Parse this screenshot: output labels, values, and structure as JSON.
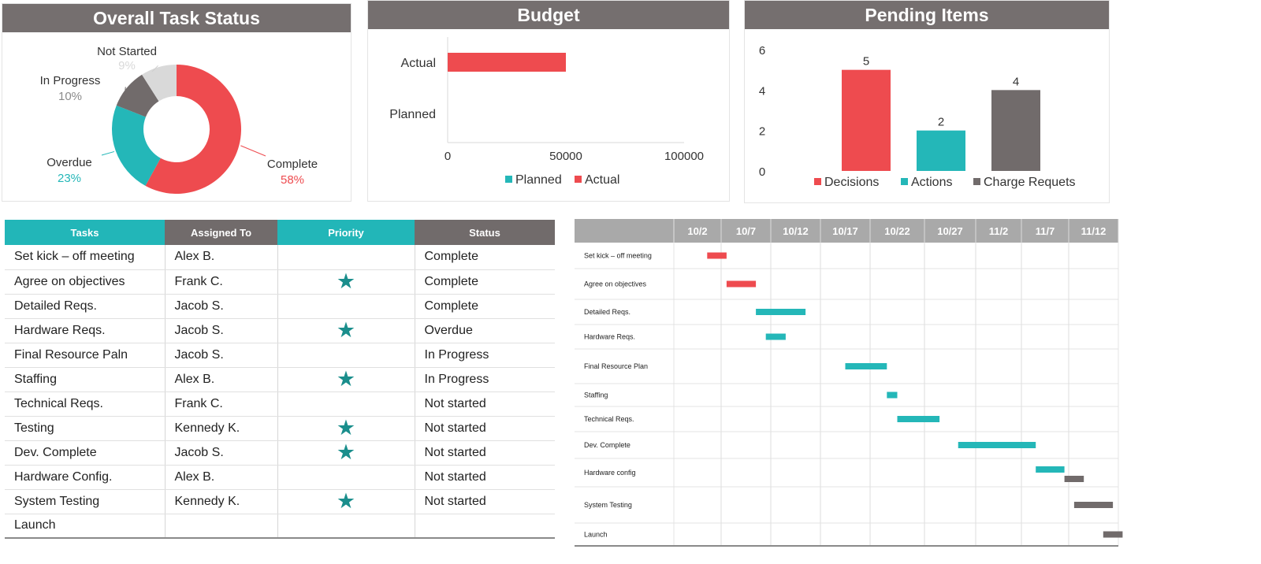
{
  "task_status": {
    "title": "Overall Task Status",
    "chart_data": {
      "type": "pie",
      "labels": [
        "Complete",
        "Overdue",
        "In Progress",
        "Not Started"
      ],
      "values": [
        58,
        23,
        10,
        9
      ],
      "value_labels": [
        "58%",
        "23%",
        "10%",
        "9%"
      ],
      "colors": [
        "#ee4b4f",
        "#24b7b8",
        "#716b6b",
        "#d9d9d9"
      ],
      "donut": true
    }
  },
  "budget": {
    "title": "Budget",
    "chart_data": {
      "type": "bar",
      "orientation": "horizontal",
      "categories": [
        "Actual",
        "Planned"
      ],
      "series": [
        {
          "name": "Planned",
          "values": [
            0,
            0
          ],
          "color": "#24b7b8"
        },
        {
          "name": "Actual",
          "values": [
            50000,
            0
          ],
          "color": "#ee4b4f"
        }
      ],
      "xlim": [
        0,
        100000
      ],
      "xticks": [
        "0",
        "50000",
        "100000"
      ],
      "legend": "bottom"
    }
  },
  "pending": {
    "title": "Pending Items",
    "chart_data": {
      "type": "bar",
      "categories": [
        "Decisions",
        "Actions",
        "Charge Requets"
      ],
      "values": [
        5,
        2,
        4
      ],
      "colors": [
        "#ee4b4f",
        "#24b7b8",
        "#716b6b"
      ],
      "ylim": [
        0,
        6
      ],
      "yticks": [
        "0",
        "2",
        "4",
        "6"
      ],
      "legend": "bottom"
    }
  },
  "task_table": {
    "headers": [
      "Tasks",
      "Assigned To",
      "Priority",
      "Status"
    ],
    "star_glyph": "★",
    "rows": [
      {
        "task": "Set kick – off meeting",
        "assigned": "Alex B.",
        "priority": false,
        "status": "Complete"
      },
      {
        "task": "Agree on objectives",
        "assigned": "Frank C.",
        "priority": true,
        "status": "Complete"
      },
      {
        "task": "Detailed Reqs.",
        "assigned": "Jacob S.",
        "priority": false,
        "status": "Complete"
      },
      {
        "task": "Hardware  Reqs.",
        "assigned": "Jacob S.",
        "priority": true,
        "status": "Overdue"
      },
      {
        "task": "Final Resource Paln",
        "assigned": "Jacob S.",
        "priority": false,
        "status": "In Progress"
      },
      {
        "task": "Staffing",
        "assigned": "Alex B.",
        "priority": true,
        "status": "In Progress"
      },
      {
        "task": "Technical Reqs.",
        "assigned": "Frank C.",
        "priority": false,
        "status": "Not started"
      },
      {
        "task": "Testing",
        "assigned": "Kennedy K.",
        "priority": true,
        "status": "Not started"
      },
      {
        "task": "Dev.  Complete",
        "assigned": "Jacob S.",
        "priority": true,
        "status": "Not started"
      },
      {
        "task": "Hardware  Config.",
        "assigned": "Alex B.",
        "priority": false,
        "status": "Not started"
      },
      {
        "task": "System Testing",
        "assigned": "Kennedy K.",
        "priority": true,
        "status": "Not started"
      },
      {
        "task": "Launch",
        "assigned": "",
        "priority": false,
        "status": ""
      }
    ]
  },
  "gantt": {
    "dates": [
      "10/2",
      "10/7",
      "10/12",
      "10/17",
      "10/22",
      "10/27",
      "11/2",
      "11/7",
      "11/12"
    ],
    "colors": {
      "red": "#ee4b4f",
      "teal": "#24b7b8",
      "gray": "#716b6b"
    },
    "tasks": [
      {
        "label": "Set kick – off meeting",
        "bars": [
          {
            "start": "10/3",
            "end": "10/5",
            "color": "red"
          }
        ]
      },
      {
        "label": "Agree on objectives",
        "bars": [
          {
            "start": "10/5",
            "end": "10/8",
            "color": "red"
          }
        ]
      },
      {
        "label": "Detailed Reqs.",
        "bars": [
          {
            "start": "10/8",
            "end": "10/13",
            "color": "teal"
          }
        ]
      },
      {
        "label": "Hardware  Reqs.",
        "bars": [
          {
            "start": "10/9",
            "end": "10/11",
            "color": "teal"
          }
        ]
      },
      {
        "label": "Final Resource Plan",
        "bars": [
          {
            "start": "10/17",
            "end": "10/21",
            "color": "teal"
          }
        ]
      },
      {
        "label": "Staffing",
        "bars": [
          {
            "start": "10/21",
            "end": "10/22",
            "color": "teal"
          }
        ]
      },
      {
        "label": "Technical Reqs.",
        "bars": [
          {
            "start": "10/22",
            "end": "10/26",
            "color": "teal"
          }
        ]
      },
      {
        "label": "Dev.  Complete",
        "bars": [
          {
            "start": "10/28",
            "end": "11/6",
            "color": "teal"
          }
        ]
      },
      {
        "label": "Hardware  config",
        "bars": [
          {
            "start": "11/6",
            "end": "11/9",
            "color": "teal"
          },
          {
            "start": "11/9",
            "end": "11/11",
            "color": "gray"
          }
        ]
      },
      {
        "label": "System Testing",
        "bars": [
          {
            "start": "11/10",
            "end": "11/14",
            "color": "gray"
          }
        ]
      },
      {
        "label": "Launch",
        "bars": [
          {
            "start": "11/13",
            "end": "11/15",
            "color": "gray"
          }
        ]
      }
    ]
  }
}
